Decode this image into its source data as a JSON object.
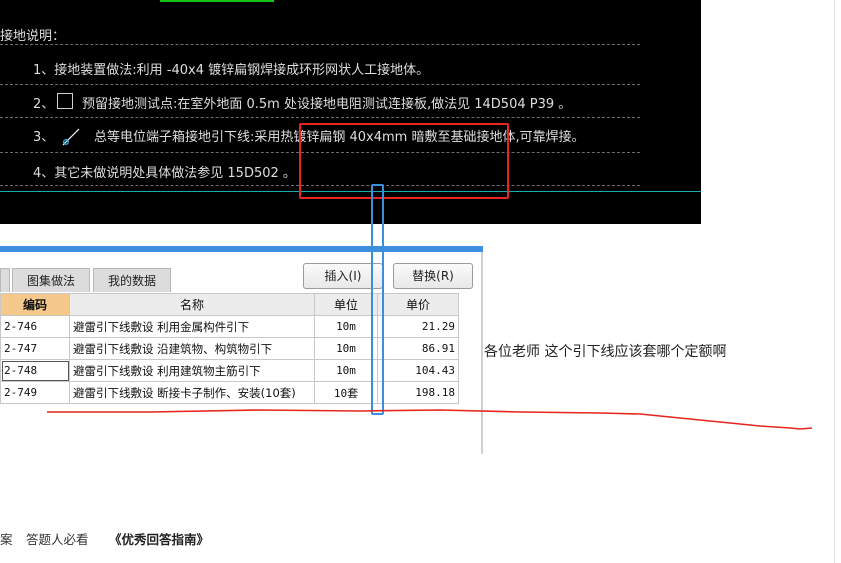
{
  "cad": {
    "heading": "接地说明：",
    "lines": [
      "1、接地装置做法:利用      -40x4   镀锌扁钢焊接成环形网状人工接地体。",
      "2、",
      "预留接地测试点:在室外地面       0.5m 处设接地电阻测试连接板,做法见        14D504    P39  。",
      "3、",
      "总等电位端子箱接地引下线:采用热镀锌扁钢              40x4mm   暗敷至基础接地体,可靠焊接。",
      "4、其它未做说明处具体做法参见       15D502    。"
    ]
  },
  "tabs": [
    "图集做法",
    "我的数据"
  ],
  "buttons": {
    "insert": "插入(I)",
    "replace": "替换(R)"
  },
  "table": {
    "headers": [
      "编码",
      "名称",
      "单位",
      "单价"
    ],
    "rows": [
      [
        "2-746",
        "避雷引下线敷设  利用金属构件引下",
        "10m",
        "21.29"
      ],
      [
        "2-747",
        "避雷引下线敷设  沿建筑物、构筑物引下",
        "10m",
        "86.91"
      ],
      [
        "2-748",
        "避雷引下线敷设  利用建筑物主筋引下",
        "10m",
        "104.43"
      ],
      [
        "2-749",
        "避雷引下线敷设  断接卡子制作、安装(10套)",
        "10套",
        "198.18"
      ]
    ]
  },
  "question": "各位老师 这个引下线应该套哪个定额啊",
  "bottom_links": [
    "案",
    "答题人必看",
    "《优秀回答指南》"
  ],
  "colors": {
    "red_highlight": "#e8251f",
    "blue_highlight": "#3b8ede",
    "header_accent": "#f4c98b",
    "window_bar": "#3d8fe0"
  }
}
